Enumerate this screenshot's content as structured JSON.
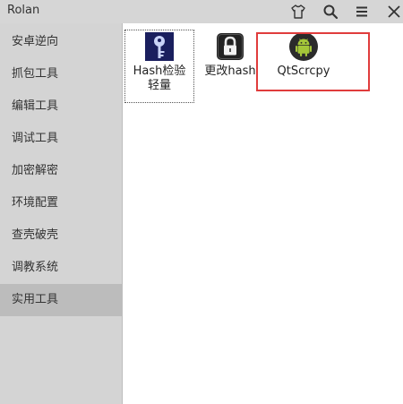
{
  "window": {
    "title": "Rolan",
    "buttons": {
      "skin": "tshirt-icon",
      "search": "search-icon",
      "menu": "menu-icon",
      "close": "close-icon"
    }
  },
  "sidebar": {
    "items": [
      {
        "label": "安卓逆向"
      },
      {
        "label": "抓包工具"
      },
      {
        "label": "编辑工具"
      },
      {
        "label": "调试工具"
      },
      {
        "label": "加密解密"
      },
      {
        "label": "环境配置"
      },
      {
        "label": "查壳破壳"
      },
      {
        "label": "调教系统"
      },
      {
        "label": "实用工具"
      }
    ]
  },
  "tools": [
    {
      "label_line1": "Hash检验",
      "label_line2": "轻量",
      "icon": "key-icon"
    },
    {
      "label_line1": "更改hash",
      "icon": "lock-icon"
    },
    {
      "label_line1": "QtScrcpy",
      "icon": "android-icon"
    }
  ],
  "colors": {
    "titlebar": "#d6d6d6",
    "sidebar": "#d4d4d4",
    "sidebar_active": "#bcbcbc",
    "highlight": "#e03c3c",
    "android_green": "#a4c639"
  }
}
